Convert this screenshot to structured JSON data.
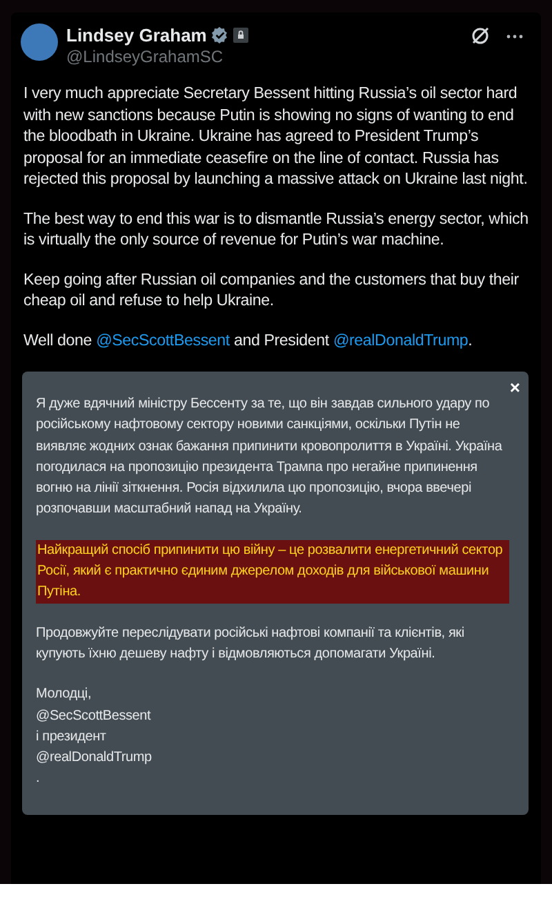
{
  "author": {
    "name": "Lindsey Graham",
    "handle": "@LindseyGrahamSC",
    "verified": true
  },
  "tweet": {
    "paragraphs": [
      [
        {
          "kind": "plain",
          "text": "I very much appreciate Secretary Bessent hitting Russia’s oil sector hard with new sanctions because Putin is showing no signs of wanting to end the bloodbath in Ukraine. Ukraine has agreed to President Trump’s proposal for an immediate ceasefire on the line of contact. Russia has rejected this proposal by launching a massive attack on Ukraine last night."
        }
      ],
      [
        {
          "kind": "plain",
          "text": "The best way to end this war is to dismantle Russia’s energy sector, which is virtually the only source of revenue for Putin’s war machine."
        }
      ],
      [
        {
          "kind": "plain",
          "text": "Keep going after Russian oil companies and the customers that buy their cheap oil and refuse to help Ukraine."
        }
      ],
      [
        {
          "kind": "plain",
          "text": "Well done "
        },
        {
          "kind": "mention",
          "text": "@SecScottBessent"
        },
        {
          "kind": "plain",
          "text": " and President "
        },
        {
          "kind": "mention",
          "text": "@realDonaldTrump"
        },
        {
          "kind": "plain",
          "text": "."
        }
      ]
    ]
  },
  "translation": {
    "close": "×",
    "paragraphs": [
      {
        "highlighted": false,
        "lines": [
          "Я дуже вдячний міністру Бессенту за те, що він завдав сильного удару по російському нафтовому сектору новими санкціями, оскільки Путін не виявляє жодних ознак бажання припинити кровопролиття в Україні. Україна погодилася на пропозицію президента Трампа про негайне припинення вогню на лінії зіткнення. Росія відхилила цю пропозицію, вчора ввечері розпочавши масштабний напад на Україну."
        ]
      },
      {
        "highlighted": true,
        "lines": [
          "Найкращий спосіб припинити цю війну – це розвалити енергетичний сектор Росії, який є практично єдиним джерелом доходів для військової машини Путіна."
        ]
      },
      {
        "highlighted": false,
        "lines": [
          "Продовжуйте переслідувати російські нафтові компанії та клієнтів, які купують їхню дешеву нафту і відмовляються допомагати Україні."
        ]
      },
      {
        "highlighted": false,
        "lines": [
          "Молодці,",
          "@SecScottBessent",
          " і президент",
          "@realDonaldTrump",
          "."
        ]
      }
    ]
  }
}
